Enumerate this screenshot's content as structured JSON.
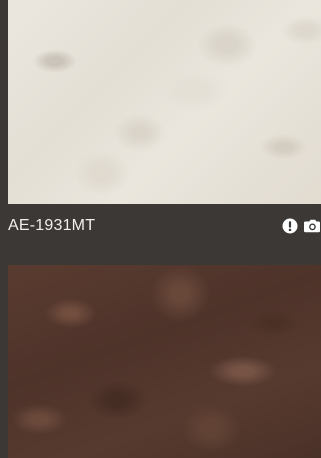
{
  "products": [
    {
      "code": "AE-1931MT",
      "swatch_color": "#e8e3da",
      "icons": [
        "info-icon",
        "camera-icon"
      ]
    },
    {
      "code": "",
      "swatch_color": "#533830"
    }
  ],
  "colors": {
    "background": "#3b3836",
    "text": "#f2efea",
    "icon": "#ffffff"
  }
}
